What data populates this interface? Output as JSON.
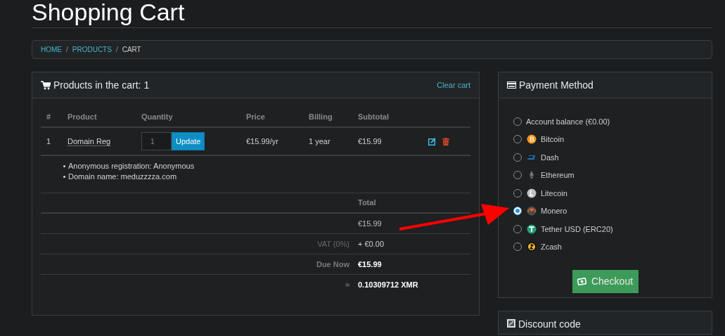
{
  "page_title": "Shopping Cart",
  "breadcrumb": [
    {
      "label": "HOME",
      "current": false
    },
    {
      "label": "PRODUCTS",
      "current": false
    },
    {
      "label": "CART",
      "current": true
    }
  ],
  "breadcrumb_separator": "/",
  "cart": {
    "title": "Products in the cart: 1",
    "clear_link": "Clear cart",
    "columns": [
      "#",
      "Product",
      "Quantity",
      "Price",
      "Billing",
      "Subtotal"
    ],
    "rows": [
      {
        "number": "1",
        "product": "Domain Reg",
        "quantity": "1",
        "update_button": "Update",
        "price": "€15.99/yr",
        "billing": "1 year",
        "subtotal": "€15.99",
        "details": [
          "Anonymous registration: Anonymous",
          "Domain name: meduzzzza.com"
        ]
      }
    ],
    "totals": [
      {
        "kind": "header",
        "value": "Total"
      },
      {
        "kind": "plain",
        "value": "€15.99"
      },
      {
        "kind": "muted",
        "label": "VAT (0%)",
        "value": "+ €0.00"
      },
      {
        "kind": "strong",
        "label": "Due Now",
        "value": "€15.99"
      },
      {
        "kind": "strong",
        "label": "≈",
        "value": "0.10309712 XMR"
      }
    ]
  },
  "payment": {
    "title": "Payment Method",
    "options": [
      {
        "label": "Account balance (€0.00)",
        "selected": false
      },
      {
        "label": "Bitcoin",
        "selected": false
      },
      {
        "label": "Dash",
        "selected": false
      },
      {
        "label": "Ethereum",
        "selected": false
      },
      {
        "label": "Litecoin",
        "selected": false
      },
      {
        "label": "Monero",
        "selected": true
      },
      {
        "label": "Tether USD (ERC20)",
        "selected": false
      },
      {
        "label": "Zcash",
        "selected": false
      }
    ],
    "checkout_button": "Checkout"
  },
  "discount": {
    "title": "Discount code"
  }
}
